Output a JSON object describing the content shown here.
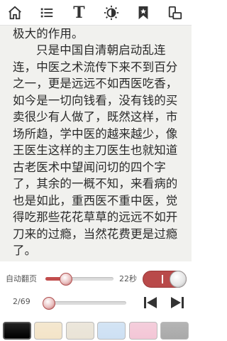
{
  "toolbar": {
    "icons": [
      "home-icon",
      "list-icon",
      "font-icon",
      "brightness-icon",
      "bookmark-icon",
      "rotate-icon"
    ],
    "font_glyph": "T"
  },
  "content": {
    "paragraphs": [
      "这里中医对于瘟疫的抑制就起了极大的作用。",
      "只是中国自清朝启动乱连连，中医之术流传下来不到百分之一，更是远远不如西医吃香，如今是一切向钱看，没有钱的买卖很少有人做了，既然这样，市场所趋，学中医的越来越少，像王医生这样的主刀医生也就知道古老医术中望闻问切的四个字了，其余的一概不知，来看病的也是如此，重西医不重中医，觉得吃那些花花草草的远远不如开刀来的过瘾，当然花费更是过瘾了。"
    ]
  },
  "controls": {
    "auto_page_label": "自动翻页",
    "speed_value": "22秒",
    "speed_fraction": 0.3,
    "auto_page_on": true,
    "page_indicator": "2/69",
    "page_fraction": 0.03
  },
  "colors": {
    "accent": "#c24d4d",
    "page_bg": "#f1f1ee",
    "themes": [
      "#000000",
      "#f3e4c8",
      "#e9e3d6",
      "#cde0f3",
      "#f3c6d6",
      "#a9a9a9"
    ],
    "selected_theme_index": 0
  }
}
